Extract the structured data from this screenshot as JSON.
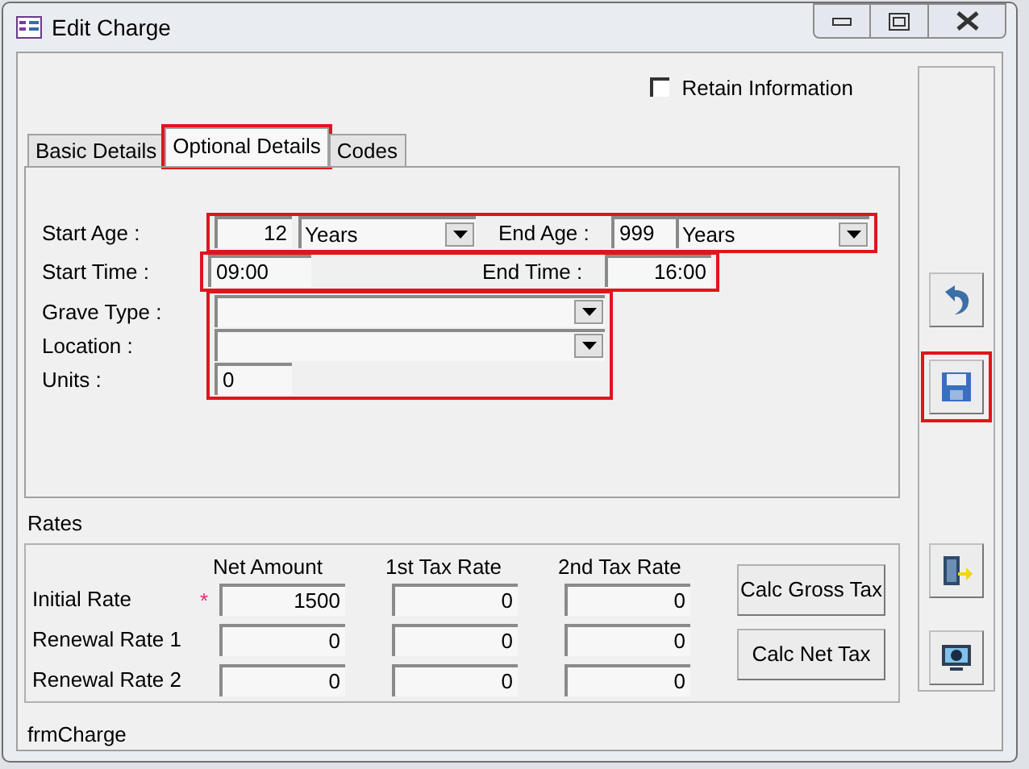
{
  "window": {
    "title": "Edit Charge"
  },
  "retain_information": {
    "label": "Retain Information",
    "checked": false
  },
  "tabs": [
    {
      "label": "Basic Details",
      "selected": false,
      "highlighted": false
    },
    {
      "label": "Optional Details",
      "selected": true,
      "highlighted": true
    },
    {
      "label": "Codes",
      "selected": false,
      "highlighted": false
    }
  ],
  "age_row": {
    "highlighted": true,
    "start_label": "Start Age :",
    "start_value": "12",
    "start_unit": "Years",
    "end_label": "End Age :",
    "end_value": "999",
    "end_unit": "Years"
  },
  "time_row": {
    "highlighted": true,
    "start_label": "Start Time :",
    "start_value": "09:00",
    "end_label": "End Time :",
    "end_value": "16:00"
  },
  "other_fields": {
    "highlighted": true,
    "fields": [
      {
        "label": "Grave Type :",
        "kind": "dropdown"
      },
      {
        "label": "Location :",
        "kind": "dropdown"
      },
      {
        "label": "Units :",
        "kind": "text",
        "value": "0"
      }
    ]
  },
  "rates": {
    "title": "Rates",
    "columns": [
      "Net Amount",
      "1st Tax Rate",
      "2nd Tax Rate"
    ],
    "rows": [
      {
        "label": "Initial Rate",
        "required_mark": "*",
        "values": [
          "1500",
          "0",
          "0"
        ]
      },
      {
        "label": "Renewal Rate 1",
        "values": [
          "0",
          "0",
          "0"
        ]
      },
      {
        "label": "Renewal Rate 2",
        "values": [
          "0",
          "0",
          "0"
        ]
      }
    ],
    "buttons": [
      "Calc Gross Tax",
      "Calc Net Tax"
    ]
  },
  "side_buttons": [
    {
      "kind": "undo",
      "highlighted": false
    },
    {
      "kind": "save",
      "highlighted": true
    },
    {
      "kind": "exit",
      "highlighted": false
    },
    {
      "kind": "screen",
      "highlighted": false
    }
  ],
  "status_bar": "frmCharge"
}
